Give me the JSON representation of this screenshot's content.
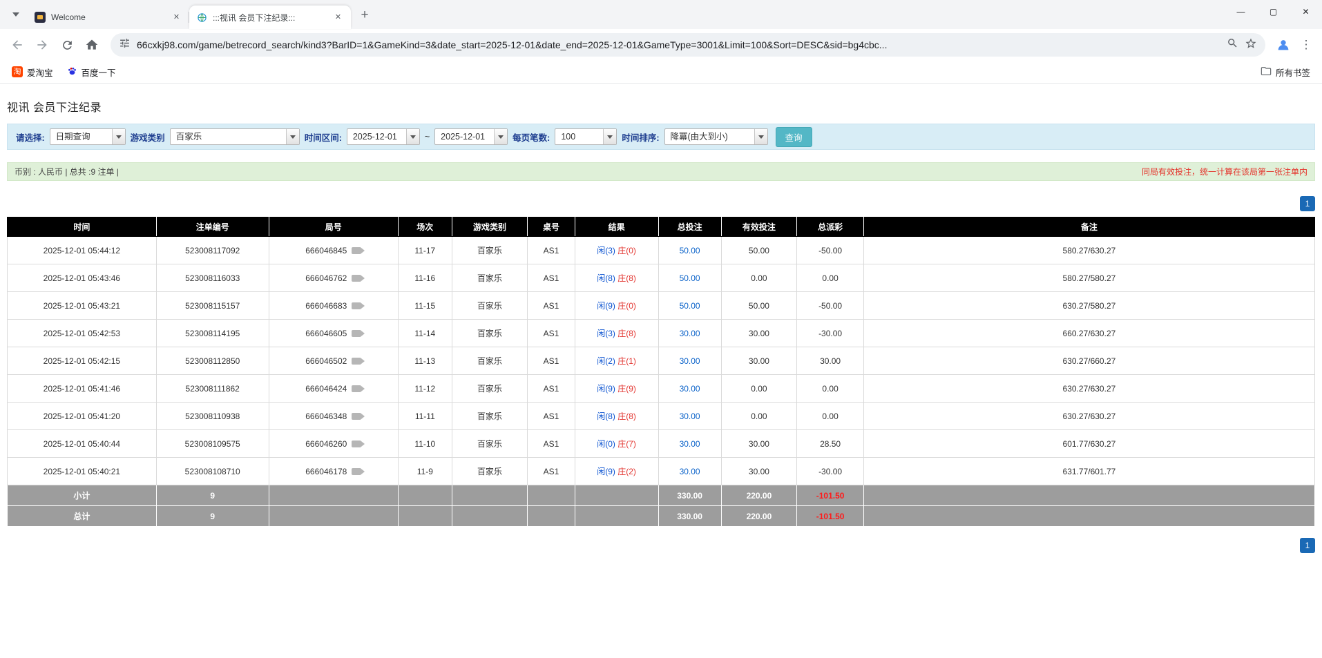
{
  "colors": {
    "accent_blue": "#1a73e8",
    "link_blue": "#0a62c9",
    "player_blue": "#0a52d0",
    "banker_red": "#e3342f",
    "negative_red": "#f50000",
    "search_button_teal": "#53b7c6",
    "filter_bar_bg": "#d8edf6",
    "info_bar_bg": "#dff0d8",
    "pagination_blue": "#1a69b5",
    "table_header_bg": "#000000",
    "table_footer_bg": "#9d9d9d"
  },
  "icons": {
    "tab_search": "chevron-down",
    "video_replay": "camera-glyph",
    "site_info": "tune-sliders",
    "zoom": "magnifier",
    "bookmark": "star-outline",
    "all_bookmarks": "folder-outline"
  },
  "browser": {
    "tabs": [
      {
        "label": "Welcome"
      },
      {
        "label": ":::视讯 会员下注纪录:::"
      }
    ],
    "url": "66cxkj98.com/game/betrecord_search/kind3?BarID=1&GameKind=3&date_start=2025-12-01&date_end=2025-12-01&GameType=3001&Limit=100&Sort=DESC&sid=bg4cbc...",
    "bookmarks": [
      {
        "label": "爱淘宝"
      },
      {
        "label": "百度一下"
      }
    ],
    "all_bookmarks_label": "所有书签"
  },
  "page": {
    "title": "视讯 会员下注纪录",
    "filters": {
      "select_label": "请选择:",
      "select_value": "日期查询",
      "game_label": "游戏类别",
      "game_value": "百家乐",
      "range_label": "时间区间:",
      "date_start": "2025-12-01",
      "tilde": "~",
      "date_end": "2025-12-01",
      "per_page_label": "每页笔数:",
      "per_page_value": "100",
      "sort_label": "时间排序:",
      "sort_value": "降冪(由大到小)",
      "search_label": "查询"
    },
    "info": {
      "left": "币别 : 人民币 | 总共 :9 注单 |",
      "right": "同局有效投注，统一计算在该局第一张注单内"
    },
    "pagination": {
      "current": "1"
    },
    "table": {
      "headers": [
        "时间",
        "注单编号",
        "局号",
        "场次",
        "游戏类别",
        "桌号",
        "结果",
        "总投注",
        "有效投注",
        "总派彩",
        "备注"
      ],
      "rows": [
        {
          "time": "2025-12-01 05:44:12",
          "bet_id": "523008117092",
          "round": "666046845",
          "session": "11-17",
          "game": "百家乐",
          "table": "AS1",
          "player": "闲(3)",
          "banker": "庄(0)",
          "total_bet": "50.00",
          "valid_bet": "50.00",
          "payout": "-50.00",
          "remark": "580.27/630.27"
        },
        {
          "time": "2025-12-01 05:43:46",
          "bet_id": "523008116033",
          "round": "666046762",
          "session": "11-16",
          "game": "百家乐",
          "table": "AS1",
          "player": "闲(8)",
          "banker": "庄(8)",
          "total_bet": "50.00",
          "valid_bet": "0.00",
          "payout": "0.00",
          "remark": "580.27/580.27"
        },
        {
          "time": "2025-12-01 05:43:21",
          "bet_id": "523008115157",
          "round": "666046683",
          "session": "11-15",
          "game": "百家乐",
          "table": "AS1",
          "player": "闲(9)",
          "banker": "庄(0)",
          "total_bet": "50.00",
          "valid_bet": "50.00",
          "payout": "-50.00",
          "remark": "630.27/580.27"
        },
        {
          "time": "2025-12-01 05:42:53",
          "bet_id": "523008114195",
          "round": "666046605",
          "session": "11-14",
          "game": "百家乐",
          "table": "AS1",
          "player": "闲(3)",
          "banker": "庄(8)",
          "total_bet": "30.00",
          "valid_bet": "30.00",
          "payout": "-30.00",
          "remark": "660.27/630.27"
        },
        {
          "time": "2025-12-01 05:42:15",
          "bet_id": "523008112850",
          "round": "666046502",
          "session": "11-13",
          "game": "百家乐",
          "table": "AS1",
          "player": "闲(2)",
          "banker": "庄(1)",
          "total_bet": "30.00",
          "valid_bet": "30.00",
          "payout": "30.00",
          "remark": "630.27/660.27"
        },
        {
          "time": "2025-12-01 05:41:46",
          "bet_id": "523008111862",
          "round": "666046424",
          "session": "11-12",
          "game": "百家乐",
          "table": "AS1",
          "player": "闲(9)",
          "banker": "庄(9)",
          "total_bet": "30.00",
          "valid_bet": "0.00",
          "payout": "0.00",
          "remark": "630.27/630.27"
        },
        {
          "time": "2025-12-01 05:41:20",
          "bet_id": "523008110938",
          "round": "666046348",
          "session": "11-11",
          "game": "百家乐",
          "table": "AS1",
          "player": "闲(8)",
          "banker": "庄(8)",
          "total_bet": "30.00",
          "valid_bet": "0.00",
          "payout": "0.00",
          "remark": "630.27/630.27"
        },
        {
          "time": "2025-12-01 05:40:44",
          "bet_id": "523008109575",
          "round": "666046260",
          "session": "11-10",
          "game": "百家乐",
          "table": "AS1",
          "player": "闲(0)",
          "banker": "庄(7)",
          "total_bet": "30.00",
          "valid_bet": "30.00",
          "payout": "28.50",
          "remark": "601.77/630.27"
        },
        {
          "time": "2025-12-01 05:40:21",
          "bet_id": "523008108710",
          "round": "666046178",
          "session": "11-9",
          "game": "百家乐",
          "table": "AS1",
          "player": "闲(9)",
          "banker": "庄(2)",
          "total_bet": "30.00",
          "valid_bet": "30.00",
          "payout": "-30.00",
          "remark": "631.77/601.77"
        }
      ],
      "footer": [
        {
          "label": "小计",
          "count": "9",
          "total_bet": "330.00",
          "valid_bet": "220.00",
          "payout": "-101.50"
        },
        {
          "label": "总计",
          "count": "9",
          "total_bet": "330.00",
          "valid_bet": "220.00",
          "payout": "-101.50"
        }
      ]
    }
  }
}
